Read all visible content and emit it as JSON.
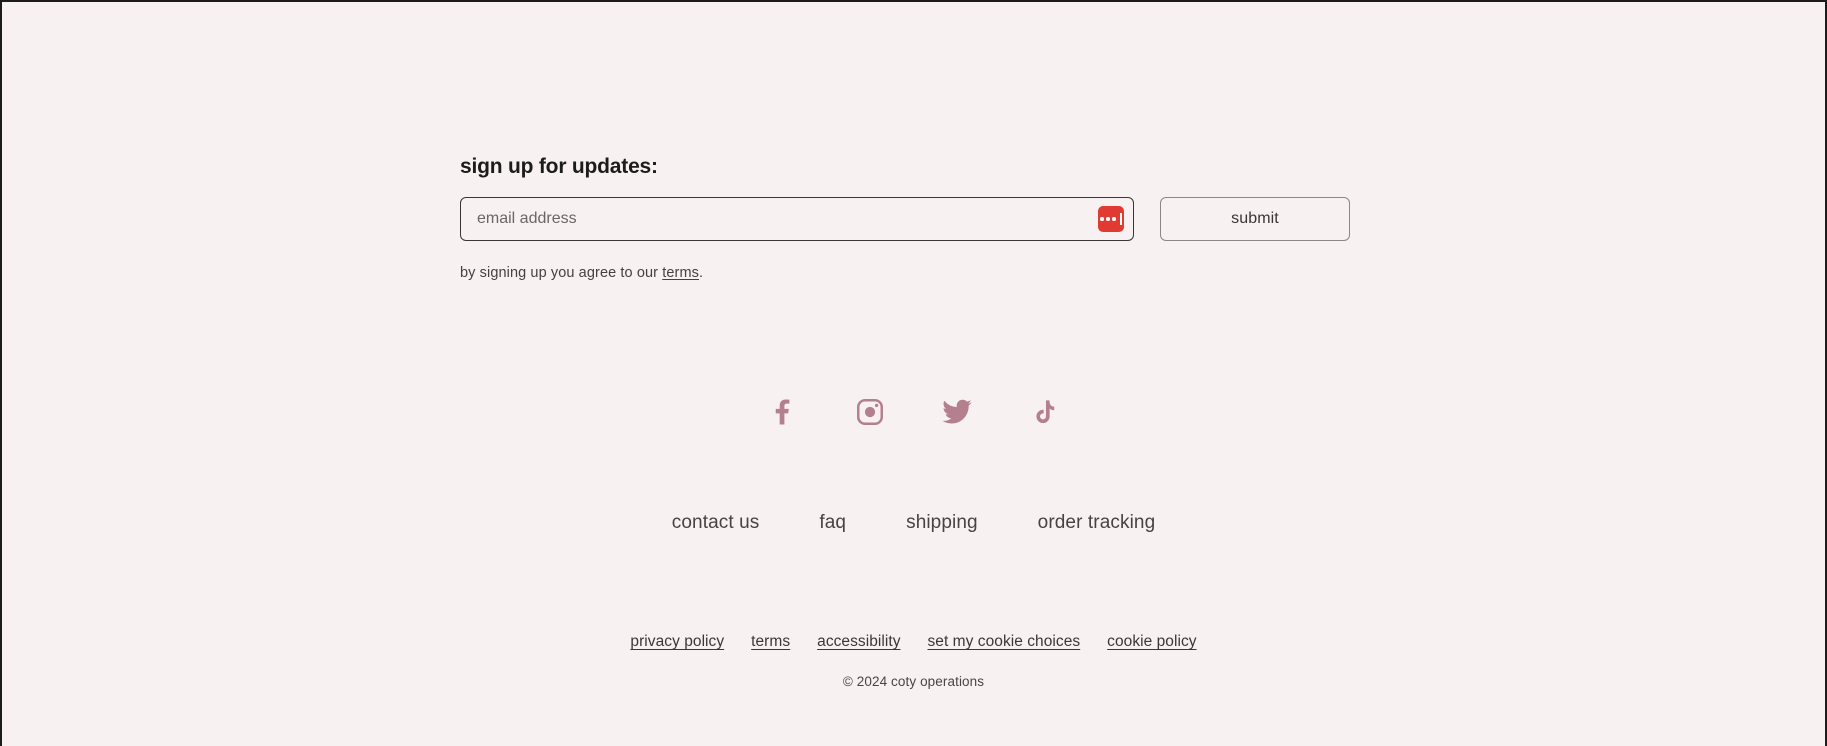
{
  "page": {
    "background_color": "#f7f1f2",
    "frame_border_color": "#1b1b1b"
  },
  "signup": {
    "heading": "sign up for updates:",
    "email_placeholder": "email address",
    "email_value": "",
    "autofill_icon": "password-manager-icon",
    "autofill_icon_color": "#e03a32",
    "submit_label": "submit",
    "consent_prefix": "by signing up you agree to our ",
    "consent_link_label": "terms",
    "consent_suffix": "."
  },
  "social": {
    "color": "#b5808e",
    "items": [
      {
        "name": "facebook",
        "icon": "facebook-icon",
        "label": "facebook"
      },
      {
        "name": "instagram",
        "icon": "instagram-icon",
        "label": "instagram"
      },
      {
        "name": "twitter",
        "icon": "twitter-icon",
        "label": "twitter"
      },
      {
        "name": "tiktok",
        "icon": "tiktok-icon",
        "label": "tiktok"
      }
    ]
  },
  "help_nav": {
    "items": [
      {
        "label": "contact us"
      },
      {
        "label": "faq"
      },
      {
        "label": "shipping"
      },
      {
        "label": "order tracking"
      }
    ]
  },
  "legal_nav": {
    "items": [
      {
        "label": "privacy policy"
      },
      {
        "label": "terms"
      },
      {
        "label": "accessibility"
      },
      {
        "label": "set my cookie choices"
      },
      {
        "label": "cookie policy"
      }
    ]
  },
  "copyright": {
    "text": "© 2024 coty operations"
  }
}
